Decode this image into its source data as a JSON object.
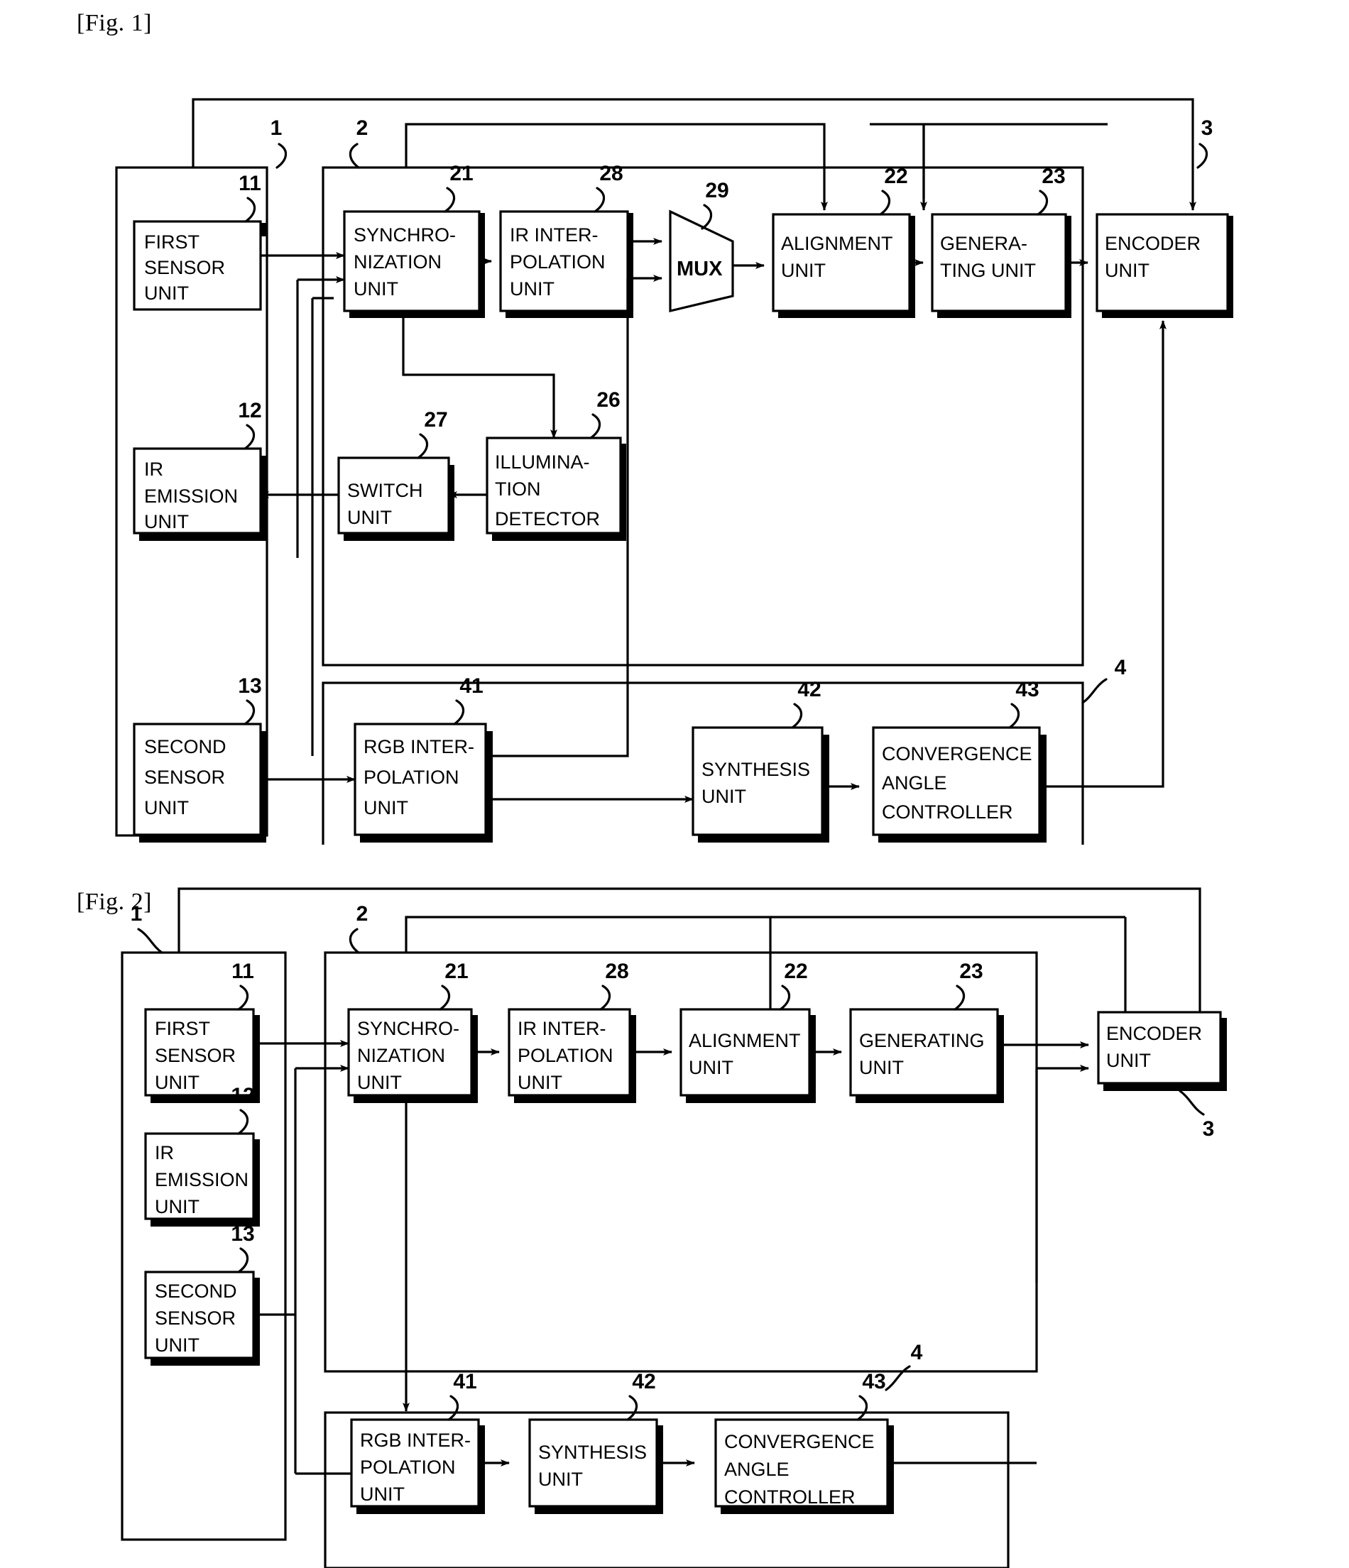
{
  "figures": [
    {
      "id": "fig1",
      "label": "[Fig. 1]",
      "group_refs": {
        "camera": "1",
        "processor": "2",
        "encoder": "3",
        "stereo": "4"
      },
      "blocks": [
        {
          "ref": "11",
          "lines": [
            "FIRST",
            "SENSOR",
            "UNIT"
          ]
        },
        {
          "ref": "12",
          "lines": [
            "IR",
            "EMISSION",
            "UNIT"
          ]
        },
        {
          "ref": "13",
          "lines": [
            "SECOND",
            "SENSOR",
            "UNIT"
          ]
        },
        {
          "ref": "21",
          "lines": [
            "SYNCHRO-",
            "NIZATION",
            "UNIT"
          ]
        },
        {
          "ref": "28",
          "lines": [
            "IR INTER-",
            "POLATION",
            "UNIT"
          ]
        },
        {
          "ref": "29",
          "lines": [
            "MUX"
          ]
        },
        {
          "ref": "22",
          "lines": [
            "ALIGNMENT",
            "UNIT"
          ]
        },
        {
          "ref": "23",
          "lines": [
            "GENERA-",
            "TING UNIT"
          ]
        },
        {
          "ref": "3",
          "lines": [
            "ENCODER",
            "UNIT"
          ]
        },
        {
          "ref": "27",
          "lines": [
            "SWITCH",
            "UNIT"
          ]
        },
        {
          "ref": "26",
          "lines": [
            "ILLUMINA-",
            "TION",
            "DETECTOR"
          ]
        },
        {
          "ref": "41",
          "lines": [
            "RGB INTER-",
            "POLATION",
            "UNIT"
          ]
        },
        {
          "ref": "42",
          "lines": [
            "SYNTHESIS",
            "UNIT"
          ]
        },
        {
          "ref": "43",
          "lines": [
            "CONVERGENCE",
            "ANGLE",
            "CONTROLLER"
          ]
        }
      ]
    },
    {
      "id": "fig2",
      "label": "[Fig. 2]",
      "group_refs": {
        "camera": "1",
        "processor": "2",
        "encoder": "3",
        "stereo": "4"
      },
      "blocks": [
        {
          "ref": "11",
          "lines": [
            "FIRST",
            "SENSOR",
            "UNIT"
          ]
        },
        {
          "ref": "12",
          "lines": [
            "IR",
            "EMISSION",
            "UNIT"
          ]
        },
        {
          "ref": "13",
          "lines": [
            "SECOND",
            "SENSOR",
            "UNIT"
          ]
        },
        {
          "ref": "21",
          "lines": [
            "SYNCHRO-",
            "NIZATION",
            "UNIT"
          ]
        },
        {
          "ref": "28",
          "lines": [
            "IR INTER-",
            "POLATION",
            "UNIT"
          ]
        },
        {
          "ref": "22",
          "lines": [
            "ALIGNMENT",
            "UNIT"
          ]
        },
        {
          "ref": "23",
          "lines": [
            "GENERATING",
            "UNIT"
          ]
        },
        {
          "ref": "3",
          "lines": [
            "ENCODER",
            "UNIT"
          ]
        },
        {
          "ref": "41",
          "lines": [
            "RGB INTER-",
            "POLATION",
            "UNIT"
          ]
        },
        {
          "ref": "42",
          "lines": [
            "SYNTHESIS",
            "UNIT"
          ]
        },
        {
          "ref": "43",
          "lines": [
            "CONVERGENCE",
            "ANGLE",
            "CONTROLLER"
          ]
        }
      ]
    }
  ],
  "colors": {
    "ink": "#000000",
    "paper": "#ffffff"
  }
}
